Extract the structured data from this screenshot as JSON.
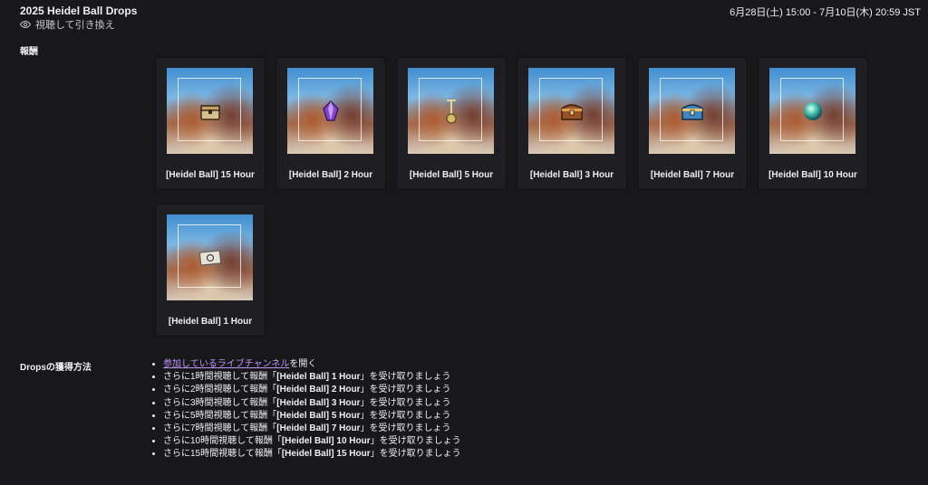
{
  "header": {
    "title": "2025 Heidel Ball Drops",
    "dates": "6月28日(土) 15:00 - 7月10日(木) 20:59 JST",
    "watch_label": "視聴して引き換え"
  },
  "rewards_section": {
    "label": "報酬",
    "items": [
      {
        "name": "[Heidel Ball] 15 Hour",
        "icon": "chest-icon"
      },
      {
        "name": "[Heidel Ball] 2 Hour",
        "icon": "crystal-icon"
      },
      {
        "name": "[Heidel Ball] 5 Hour",
        "icon": "key-icon"
      },
      {
        "name": "[Heidel Ball] 3 Hour",
        "icon": "treasure-chest-icon"
      },
      {
        "name": "[Heidel Ball] 7 Hour",
        "icon": "blue-chest-icon"
      },
      {
        "name": "[Heidel Ball] 10 Hour",
        "icon": "orb-icon"
      },
      {
        "name": "[Heidel Ball] 1 Hour",
        "icon": "ticket-icon"
      }
    ]
  },
  "how_to_section": {
    "label": "Dropsの獲得方法",
    "first_step": {
      "link_text": "参加しているライブチャンネル",
      "suffix": "を開く"
    },
    "steps": [
      {
        "prefix": "さらに1時間視聴して報酬「",
        "reward": "[Heidel Ball] 1 Hour",
        "suffix": "」を受け取りましょう"
      },
      {
        "prefix": "さらに2時間視聴して報酬「",
        "reward": "[Heidel Ball] 2 Hour",
        "suffix": "」を受け取りましょう"
      },
      {
        "prefix": "さらに3時間視聴して報酬「",
        "reward": "[Heidel Ball] 3 Hour",
        "suffix": "」を受け取りましょう"
      },
      {
        "prefix": "さらに5時間視聴して報酬「",
        "reward": "[Heidel Ball] 5 Hour",
        "suffix": "」を受け取りましょう"
      },
      {
        "prefix": "さらに7時間視聴して報酬「",
        "reward": "[Heidel Ball] 7 Hour",
        "suffix": "」を受け取りましょう"
      },
      {
        "prefix": "さらに10時間視聴して報酬「",
        "reward": "[Heidel Ball] 10 Hour",
        "suffix": "」を受け取りましょう"
      },
      {
        "prefix": "さらに15時間視聴して報酬「",
        "reward": "[Heidel Ball] 15 Hour",
        "suffix": "」を受け取りましょう"
      }
    ]
  },
  "colors": {
    "background": "#18181b",
    "card": "#1f1f23",
    "link": "#bf94ff",
    "text": "#efeff1"
  }
}
